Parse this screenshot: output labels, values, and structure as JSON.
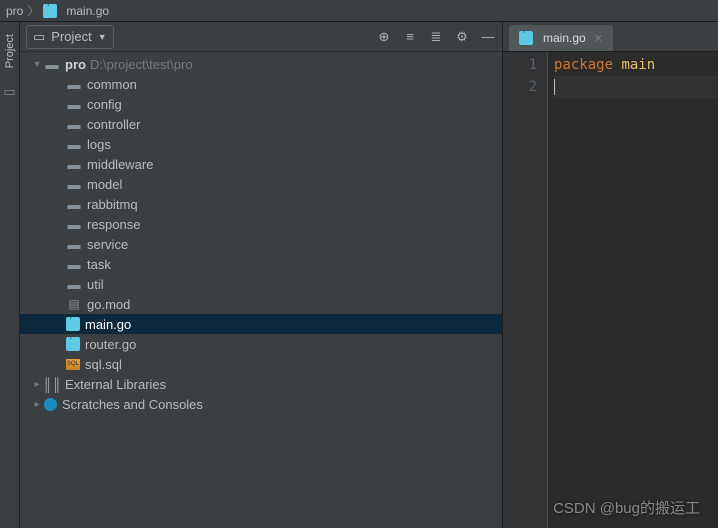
{
  "breadcrumb": {
    "root": "pro",
    "file": "main.go"
  },
  "sidebar": {
    "panel_label": "Project",
    "project_dropdown": "Project"
  },
  "tree": {
    "root_name": "pro",
    "root_path": "D:\\project\\test\\pro",
    "folders": [
      "common",
      "config",
      "controller",
      "logs",
      "middleware",
      "model",
      "rabbitmq",
      "response",
      "service",
      "task",
      "util"
    ],
    "files": {
      "gomod": "go.mod",
      "main": "main.go",
      "router": "router.go",
      "sql": "sql.sql"
    },
    "external_libs": "External Libraries",
    "scratches": "Scratches and Consoles"
  },
  "editor": {
    "tab_label": "main.go",
    "lines": {
      "l1_kw": "package",
      "l1_ident": "main"
    },
    "gutter": [
      "1",
      "2"
    ]
  },
  "watermark": "CSDN @bug的搬运工"
}
